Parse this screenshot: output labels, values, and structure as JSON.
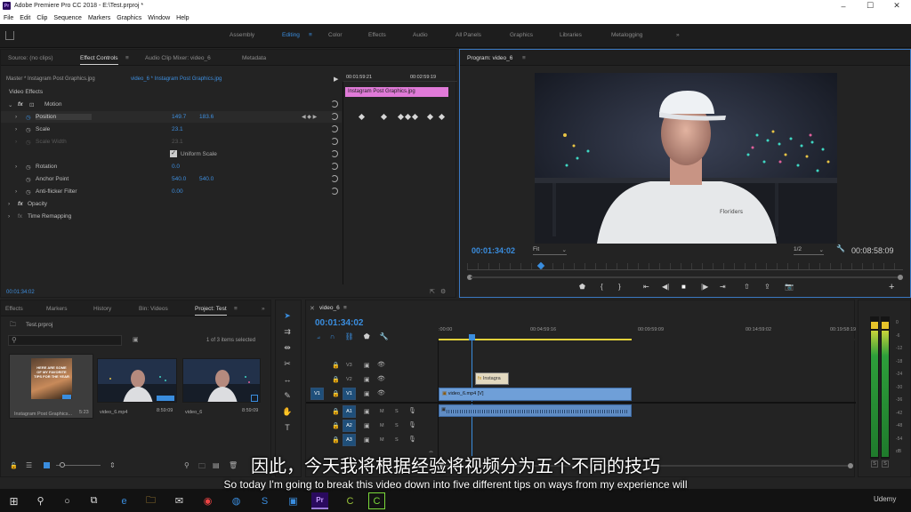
{
  "window": {
    "title": "Adobe Premiere Pro CC 2018 - E:\\Test.prproj *",
    "app_icon": "Pr",
    "minimize": "–",
    "maximize": "☐",
    "close": "✕"
  },
  "menu": [
    "File",
    "Edit",
    "Clip",
    "Sequence",
    "Markers",
    "Graphics",
    "Window",
    "Help"
  ],
  "workspaces": [
    "Assembly",
    "Editing",
    "Color",
    "Effects",
    "Audio",
    "All Panels",
    "Graphics",
    "Libraries",
    "Metalogging"
  ],
  "workspace_active": "Editing",
  "source_panel": {
    "tabs": [
      "Source: (no clips)",
      "Effect Controls",
      "Audio Clip Mixer: video_6",
      "Metadata"
    ],
    "master_label": "Master * Instagram Post Graphics.jpg",
    "clip_label": "video_6 * Instagram Post Graphics.jpg",
    "ruler_start": "00:01:59:21",
    "ruler_end": "00:02:59:19",
    "clip_bar": "Instagram Post Graphics.jpg",
    "section": "Video Effects",
    "fx": "fx",
    "motion": "Motion",
    "props": [
      {
        "name": "Position",
        "v1": "149.7",
        "v2": "183.6"
      },
      {
        "name": "Scale",
        "v1": "23.1",
        "v2": ""
      },
      {
        "name": "Scale Width",
        "v1": "23.1",
        "v2": ""
      },
      {
        "name": "Uniform Scale",
        "v1": "",
        "v2": ""
      },
      {
        "name": "Rotation",
        "v1": "0.0",
        "v2": ""
      },
      {
        "name": "Anchor Point",
        "v1": "540.0",
        "v2": "540.0"
      },
      {
        "name": "Anti-flicker Filter",
        "v1": "0.00",
        "v2": ""
      }
    ],
    "opacity": "Opacity",
    "time_remap": "Time Remapping",
    "timecode": "00:01:34:02"
  },
  "program": {
    "title": "Program: video_6",
    "timecode": "00:01:34:02",
    "fit": "Fit",
    "resolution": "1/2",
    "duration": "00:08:58:09",
    "shirt_text": "Floriders",
    "playhead_fraction": 0.17
  },
  "project_panel": {
    "tabs": [
      "Effects",
      "Markers",
      "History",
      "Bin: Videos",
      "Project: Test"
    ],
    "project_name": "Test.prproj",
    "count": "1 of 3 items selected",
    "items": [
      {
        "name": "Instagram Post Graphics...",
        "duration": "5:23",
        "thumb_text": "HERE ARE SOME OF MY FAVORITE TIPS FOR THE YEAR"
      },
      {
        "name": "video_6.mp4",
        "duration": "8:59:09",
        "thumb_text": ""
      },
      {
        "name": "video_6",
        "duration": "8:59:09",
        "thumb_text": ""
      }
    ]
  },
  "timeline": {
    "tab": "video_6",
    "timecode": "00:01:34:02",
    "ruler": [
      ":00:00",
      "00:04:59:16",
      "00:09:59:09",
      "00:14:59:02",
      "00:19:58:19"
    ],
    "tracks": [
      {
        "source": "",
        "name": "V3",
        "lock": "🔒"
      },
      {
        "source": "",
        "name": "V2",
        "lock": "🔒"
      },
      {
        "source": "V1",
        "name": "V1",
        "lock": "🔒"
      },
      {
        "source": "",
        "name": "A1",
        "lock": "🔒",
        "m": "M",
        "s": "S"
      },
      {
        "source": "",
        "name": "A2",
        "lock": "🔒",
        "m": "M",
        "s": "S"
      },
      {
        "source": "",
        "name": "A3",
        "lock": "🔒",
        "m": "M",
        "s": "S"
      }
    ],
    "clip_graphic": "Instagra",
    "clip_video": "video_6.mp4 [V]",
    "playhead_fraction": 0.17
  },
  "meters": {
    "labels": [
      "0",
      "-6",
      "-12",
      "-18",
      "-24",
      "-30",
      "-36",
      "-42",
      "-48",
      "-54",
      "dB"
    ],
    "solo": "S"
  },
  "subtitles": {
    "zh": "因此，今天我将根据经验将视频分为五个不同的技巧",
    "en": "So today I'm going to break this video down into five different tips on ways from my experience will"
  },
  "taskbar": {
    "watermark": "Udemy"
  },
  "colors": {
    "accent_blue": "#3a8dde",
    "clip_pink": "#e07ad8",
    "clip_video_blue": "#6f9fd8",
    "timeline_yellow": "#e2d13a"
  }
}
